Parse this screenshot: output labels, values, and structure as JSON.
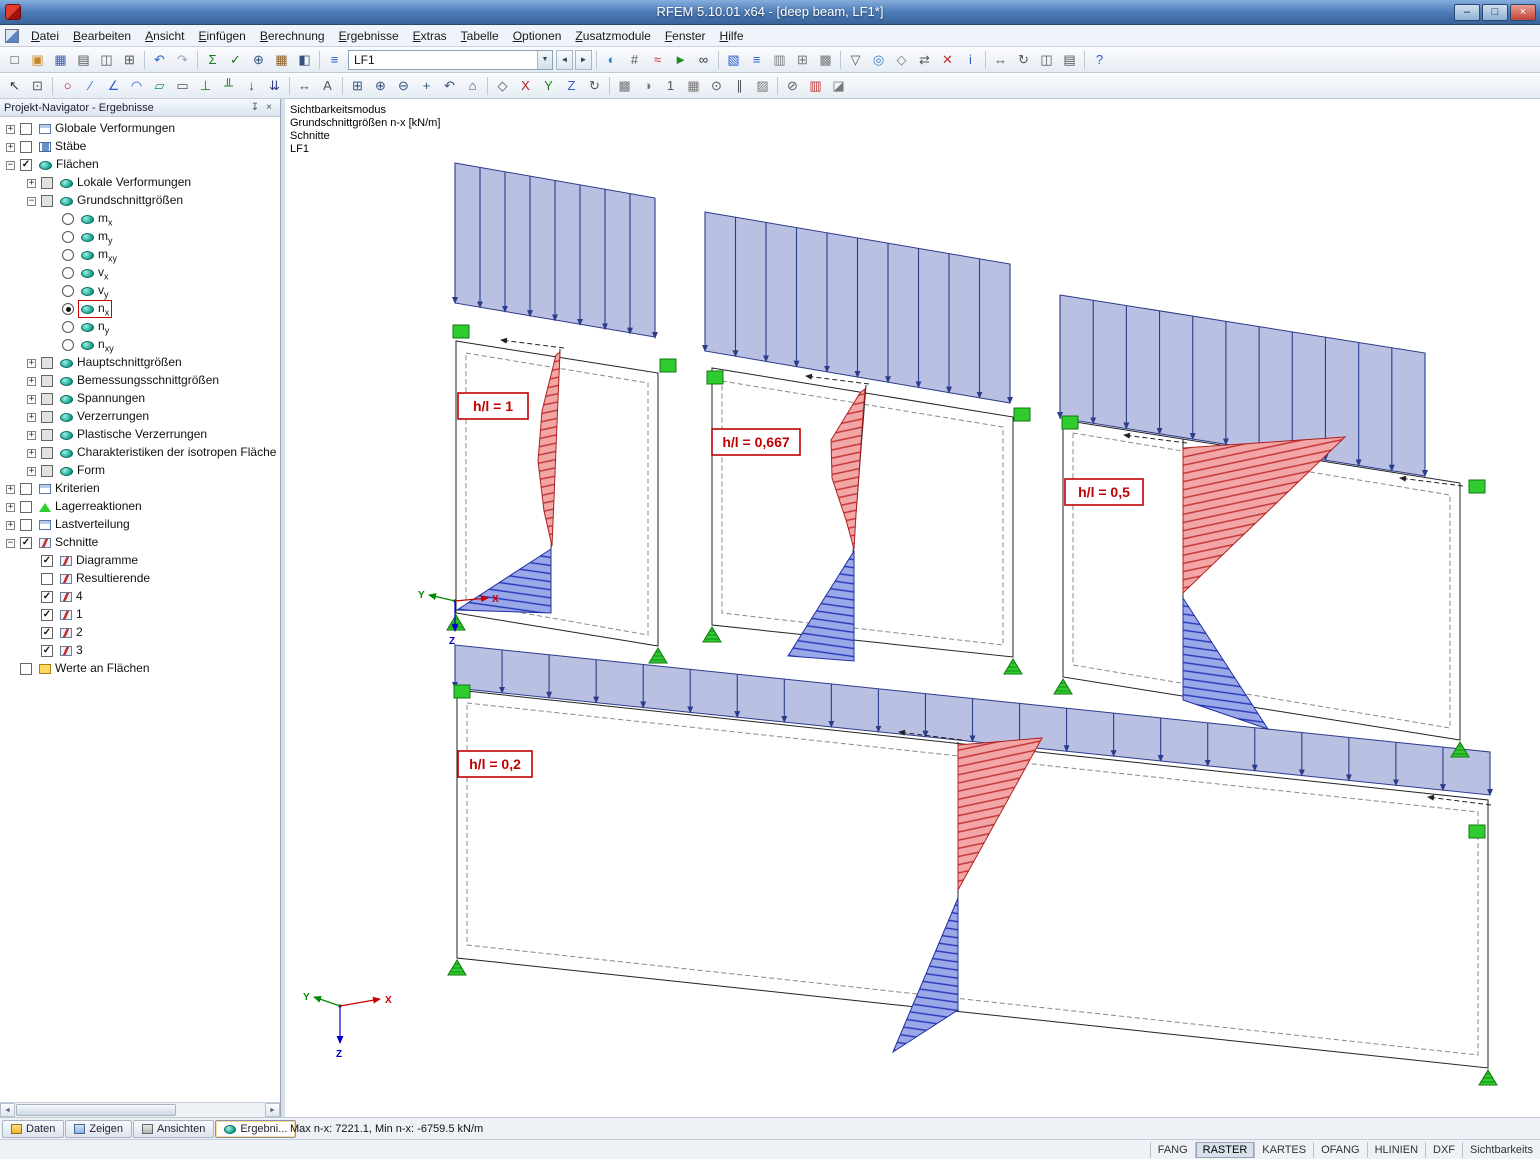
{
  "window": {
    "title": "RFEM 5.10.01 x64 - [deep beam, LF1*]",
    "controls": {
      "minimize": "–",
      "maximize": "□",
      "close": "×"
    }
  },
  "menubar": [
    {
      "n": "menu-datei",
      "label": "Datei"
    },
    {
      "n": "menu-bearbeiten",
      "label": "Bearbeiten"
    },
    {
      "n": "menu-ansicht",
      "label": "Ansicht"
    },
    {
      "n": "menu-einfuegen",
      "label": "Einfügen"
    },
    {
      "n": "menu-berechnung",
      "label": "Berechnung"
    },
    {
      "n": "menu-ergebnisse",
      "label": "Ergebnisse"
    },
    {
      "n": "menu-extras",
      "label": "Extras"
    },
    {
      "n": "menu-tabelle",
      "label": "Tabelle"
    },
    {
      "n": "menu-optionen",
      "label": "Optionen"
    },
    {
      "n": "menu-zusatzmodule",
      "label": "Zusatzmodule"
    },
    {
      "n": "menu-fenster",
      "label": "Fenster"
    },
    {
      "n": "menu-hilfe",
      "label": "Hilfe"
    }
  ],
  "toolbar1": {
    "g1": [
      {
        "n": "new-file-button",
        "g": "□",
        "c": "#444"
      },
      {
        "n": "open-file-button",
        "g": "▣",
        "c": "#c8861f"
      },
      {
        "n": "save-button",
        "g": "▦",
        "c": "#3a5fae"
      },
      {
        "n": "print-button",
        "g": "▤",
        "c": "#555"
      },
      {
        "n": "print-preview-button",
        "g": "◫",
        "c": "#555"
      },
      {
        "n": "copy-button",
        "g": "⊞",
        "c": "#555"
      }
    ],
    "g2": [
      {
        "n": "undo-button",
        "g": "↶",
        "c": "#2b5fd0"
      },
      {
        "n": "redo-button",
        "g": "↷",
        "c": "#9aa4b4"
      }
    ],
    "g3": [
      {
        "n": "calculation-button",
        "g": "Σ",
        "c": "#1a7a1a"
      },
      {
        "n": "check-button",
        "g": "✓",
        "c": "#1a7a1a"
      },
      {
        "n": "zoom-button",
        "g": "⊕",
        "c": "#33527e"
      },
      {
        "n": "tables-button",
        "g": "▦",
        "c": "#8a5a20"
      },
      {
        "n": "navigator-button",
        "g": "◧",
        "c": "#33527e"
      }
    ],
    "load_case": {
      "icon": "≡",
      "value": "LF1",
      "arrow": "▼",
      "prev": "◄",
      "next": "►"
    },
    "g5": [
      {
        "n": "show-results-button",
        "g": "◐",
        "c": "#2b7fd0"
      },
      {
        "n": "result-values-button",
        "g": "#",
        "c": "#555"
      },
      {
        "n": "result-diagrams-button",
        "g": "≈",
        "c": "#c03030"
      },
      {
        "n": "animation-button",
        "g": "►",
        "c": "#1a8a1a"
      },
      {
        "n": "view-results-button",
        "g": "∞",
        "c": "#333"
      }
    ],
    "g6": [
      {
        "n": "colored-results-button",
        "g": "▧",
        "c": "#2b5fd0"
      },
      {
        "n": "isolines-button",
        "g": "≡",
        "c": "#2b5fd0"
      },
      {
        "n": "panel-toggle-button",
        "g": "▥",
        "c": "#777"
      },
      {
        "n": "fe-mesh-button",
        "g": "⊞",
        "c": "#777"
      },
      {
        "n": "mesh-settings-button",
        "g": "▩",
        "c": "#777"
      }
    ],
    "g7": [
      {
        "n": "filter-button",
        "g": "▽",
        "c": "#555"
      },
      {
        "n": "visibility-button",
        "g": "◎",
        "c": "#2b7fd0"
      },
      {
        "n": "user-view-button",
        "g": "◇",
        "c": "#777"
      },
      {
        "n": "mirror-button",
        "g": "⇄",
        "c": "#555"
      },
      {
        "n": "delete-results-button",
        "g": "✕",
        "c": "#c03030"
      },
      {
        "n": "info-button",
        "g": "i",
        "c": "#2b5fd0"
      }
    ],
    "g8": [
      {
        "n": "move-button",
        "g": "↔",
        "c": "#555"
      },
      {
        "n": "rotate-button",
        "g": "↻",
        "c": "#555"
      },
      {
        "n": "new-window-button",
        "g": "◫",
        "c": "#555"
      },
      {
        "n": "print-graphic-button",
        "g": "▤",
        "c": "#555"
      }
    ],
    "g9": [
      {
        "n": "help-button",
        "g": "?",
        "c": "#2b5fd0"
      }
    ]
  },
  "toolbar2": {
    "h1": [
      {
        "n": "select-button",
        "g": "↖",
        "c": "#333"
      },
      {
        "n": "select-window-button",
        "g": "⊡",
        "c": "#555"
      }
    ],
    "h2": [
      {
        "n": "node-button",
        "g": "○",
        "c": "#b02020"
      },
      {
        "n": "line-button",
        "g": "∕",
        "c": "#2b5fd0"
      },
      {
        "n": "polyline-button",
        "g": "∠",
        "c": "#2b5fd0"
      },
      {
        "n": "arc-button",
        "g": "◠",
        "c": "#2b5fd0"
      },
      {
        "n": "surface-button",
        "g": "▱",
        "c": "#1a8a6a"
      },
      {
        "n": "opening-button",
        "g": "▭",
        "c": "#555"
      },
      {
        "n": "node-support-button",
        "g": "⊥",
        "c": "#1a7a1a"
      },
      {
        "n": "line-support-button",
        "g": "╨",
        "c": "#1a7a1a"
      },
      {
        "n": "member-load-button",
        "g": "↓",
        "c": "#2b3c8c"
      },
      {
        "n": "surface-load-button",
        "g": "⇊",
        "c": "#2b3c8c"
      }
    ],
    "h3": [
      {
        "n": "dimension-button",
        "g": "↔",
        "c": "#555"
      },
      {
        "n": "text-button",
        "g": "A",
        "c": "#555"
      }
    ],
    "h4": [
      {
        "n": "zoom-window-button",
        "g": "⊞",
        "c": "#33527e"
      },
      {
        "n": "zoom-in-button",
        "g": "⊕",
        "c": "#33527e"
      },
      {
        "n": "zoom-out-button",
        "g": "⊖",
        "c": "#33527e"
      },
      {
        "n": "pan-button",
        "g": "+",
        "c": "#33527e"
      },
      {
        "n": "previous-view-button",
        "g": "↶",
        "c": "#33527e"
      },
      {
        "n": "show-all-button",
        "g": "⌂",
        "c": "#33527e"
      }
    ],
    "h5": [
      {
        "n": "isometric-view-button",
        "g": "◇",
        "c": "#555"
      },
      {
        "n": "view-x-button",
        "g": "X",
        "c": "#b02020"
      },
      {
        "n": "view-y-button",
        "g": "Y",
        "c": "#1a7a1a"
      },
      {
        "n": "view-z-button",
        "g": "Z",
        "c": "#2b5fd0"
      },
      {
        "n": "rotate-view-button",
        "g": "↻",
        "c": "#555"
      }
    ],
    "h6": [
      {
        "n": "render-button",
        "g": "▩",
        "c": "#777"
      },
      {
        "n": "shadow-button",
        "g": "◑",
        "c": "#777"
      },
      {
        "n": "numbering-button",
        "g": "1",
        "c": "#555"
      },
      {
        "n": "grid-button",
        "g": "▦",
        "c": "#777"
      },
      {
        "n": "snap-button",
        "g": "⊙",
        "c": "#555"
      },
      {
        "n": "guidelines-button",
        "g": "∥",
        "c": "#555"
      },
      {
        "n": "work-plane-button",
        "g": "▨",
        "c": "#777"
      }
    ],
    "h7": [
      {
        "n": "clipping-button",
        "g": "⊘",
        "c": "#555"
      },
      {
        "n": "color-scale-button",
        "g": "▥",
        "c": "#c03030"
      },
      {
        "n": "background-button",
        "g": "◪",
        "c": "#777"
      }
    ]
  },
  "navigator": {
    "title": "Projekt-Navigator - Ergebnisse",
    "pin": "↧",
    "close": "×",
    "scrollbar": {
      "left": "◄",
      "right": "►"
    },
    "tree": [
      {
        "n": "tree-item-globale-verformungen",
        "label": "Globale Verformungen",
        "sub": "",
        "lvl": 0,
        "exp": "+",
        "chk": "box",
        "icon": "ic-window"
      },
      {
        "n": "tree-item-staebe",
        "label": "Stäbe",
        "sub": "",
        "lvl": 0,
        "exp": "+",
        "chk": "box",
        "icon": "ic-beam"
      },
      {
        "n": "tree-item-flaechen",
        "label": "Flächen",
        "sub": "",
        "lvl": 0,
        "exp": "−",
        "chk": "box on",
        "icon": "ic-oval"
      },
      {
        "n": "tree-item-lokale-verformungen",
        "label": "Lokale Verformungen",
        "sub": "",
        "lvl": 1,
        "exp": "+",
        "chk": "box grey",
        "icon": "ic-oval"
      },
      {
        "n": "tree-item-grundschnittgroessen",
        "label": "Grundschnittgrößen",
        "sub": "",
        "lvl": 1,
        "exp": "−",
        "chk": "box grey",
        "icon": "ic-oval"
      },
      {
        "n": "tree-item-mx",
        "label": "m",
        "sub": "x",
        "lvl": 2,
        "exp": "",
        "chk": "radio",
        "icon": "ic-oval"
      },
      {
        "n": "tree-item-my",
        "label": "m",
        "sub": "y",
        "lvl": 2,
        "exp": "",
        "chk": "radio",
        "icon": "ic-oval"
      },
      {
        "n": "tree-item-mxy",
        "label": "m",
        "sub": "xy",
        "lvl": 2,
        "exp": "",
        "chk": "radio",
        "icon": "ic-oval"
      },
      {
        "n": "tree-item-vx",
        "label": "v",
        "sub": "x",
        "lvl": 2,
        "exp": "",
        "chk": "radio",
        "icon": "ic-oval"
      },
      {
        "n": "tree-item-vy",
        "label": "v",
        "sub": "y",
        "lvl": 2,
        "exp": "",
        "chk": "radio",
        "icon": "ic-oval"
      },
      {
        "n": "tree-item-nx",
        "label": "n",
        "sub": "x",
        "lvl": 2,
        "exp": "",
        "chk": "radio on",
        "icon": "ic-oval",
        "sel": "sel"
      },
      {
        "n": "tree-item-ny",
        "label": "n",
        "sub": "y",
        "lvl": 2,
        "exp": "",
        "chk": "radio",
        "icon": "ic-oval"
      },
      {
        "n": "tree-item-nxy",
        "label": "n",
        "sub": "xy",
        "lvl": 2,
        "exp": "",
        "chk": "radio",
        "icon": "ic-oval"
      },
      {
        "n": "tree-item-hauptschnittgroessen",
        "label": "Hauptschnittgrößen",
        "sub": "",
        "lvl": 1,
        "exp": "+",
        "chk": "box grey",
        "icon": "ic-oval"
      },
      {
        "n": "tree-item-bemessungsschnittgroessen",
        "label": "Bemessungsschnittgrößen",
        "sub": "",
        "lvl": 1,
        "exp": "+",
        "chk": "box grey",
        "icon": "ic-oval"
      },
      {
        "n": "tree-item-spannungen",
        "label": "Spannungen",
        "sub": "",
        "lvl": 1,
        "exp": "+",
        "chk": "box grey",
        "icon": "ic-oval"
      },
      {
        "n": "tree-item-verzerrungen",
        "label": "Verzerrungen",
        "sub": "",
        "lvl": 1,
        "exp": "+",
        "chk": "box grey",
        "icon": "ic-oval"
      },
      {
        "n": "tree-item-plastische-verzerrungen",
        "label": "Plastische Verzerrungen",
        "sub": "",
        "lvl": 1,
        "exp": "+",
        "chk": "box grey",
        "icon": "ic-oval"
      },
      {
        "n": "tree-item-charakteristiken",
        "label": "Charakteristiken der isotropen Fläche",
        "sub": "",
        "lvl": 1,
        "exp": "+",
        "chk": "box grey",
        "icon": "ic-oval"
      },
      {
        "n": "tree-item-form",
        "label": "Form",
        "sub": "",
        "lvl": 1,
        "exp": "+",
        "chk": "box grey",
        "icon": "ic-oval"
      },
      {
        "n": "tree-item-kriterien",
        "label": "Kriterien",
        "sub": "",
        "lvl": 0,
        "exp": "+",
        "chk": "box",
        "icon": "ic-window"
      },
      {
        "n": "tree-item-lagerreaktionen",
        "label": "Lagerreaktionen",
        "sub": "",
        "lvl": 0,
        "exp": "+",
        "chk": "box",
        "icon": "ic-support"
      },
      {
        "n": "tree-item-lastverteilung",
        "label": "Lastverteilung",
        "sub": "",
        "lvl": 0,
        "exp": "+",
        "chk": "box",
        "icon": "ic-window"
      },
      {
        "n": "tree-item-schnitte",
        "label": "Schnitte",
        "sub": "",
        "lvl": 0,
        "exp": "−",
        "chk": "box on",
        "icon": "ic-section"
      },
      {
        "n": "tree-item-diagramme",
        "label": "Diagramme",
        "sub": "",
        "lvl": 1,
        "exp": "",
        "chk": "box on",
        "icon": "ic-section"
      },
      {
        "n": "tree-item-resultierende",
        "label": "Resultierende",
        "sub": "",
        "lvl": 1,
        "exp": "",
        "chk": "box",
        "icon": "ic-section"
      },
      {
        "n": "tree-item-schnitt-4",
        "label": "4",
        "sub": "",
        "lvl": 1,
        "exp": "",
        "chk": "box on",
        "icon": "ic-section"
      },
      {
        "n": "tree-item-schnitt-1",
        "label": "1",
        "sub": "",
        "lvl": 1,
        "exp": "",
        "chk": "box on",
        "icon": "ic-section"
      },
      {
        "n": "tree-item-schnitt-2",
        "label": "2",
        "sub": "",
        "lvl": 1,
        "exp": "",
        "chk": "box on",
        "icon": "ic-section"
      },
      {
        "n": "tree-item-schnitt-3",
        "label": "3",
        "sub": "",
        "lvl": 1,
        "exp": "",
        "chk": "box on",
        "icon": "ic-section"
      },
      {
        "n": "tree-item-werte-an-flaechen",
        "label": "Werte an Flächen",
        "sub": "",
        "lvl": 0,
        "exp": "",
        "chk": "box",
        "icon": "ic-xls"
      }
    ]
  },
  "tabs": [
    {
      "n": "tab-daten",
      "label": "Daten",
      "icon": "tabic-daten"
    },
    {
      "n": "tab-zeigen",
      "label": "Zeigen",
      "icon": "tabic-zeigen"
    },
    {
      "n": "tab-ansichten",
      "label": "Ansichten",
      "icon": "tabic-ansichten"
    },
    {
      "n": "tab-ergebnisse",
      "label": "Ergebni...",
      "icon": "tabic-ergebnisse",
      "cls": "active"
    }
  ],
  "result_info": "Max n-x: 7221.1, Min n-x: -6759.5 kN/m",
  "statusbar": [
    {
      "n": "statusbar-toggle-fang",
      "label": "FANG"
    },
    {
      "n": "statusbar-toggle-raster",
      "label": "RASTER",
      "cls": "on"
    },
    {
      "n": "statusbar-toggle-kartes",
      "label": "KARTES"
    },
    {
      "n": "statusbar-toggle-ofang",
      "label": "OFANG"
    },
    {
      "n": "statusbar-toggle-hlinien",
      "label": "HLINIEN"
    },
    {
      "n": "statusbar-toggle-dxf",
      "label": "DXF"
    },
    {
      "n": "statusbar-toggle-sichtbarkeits",
      "label": "Sichtbarkeits"
    }
  ],
  "canvas": {
    "info_lines": [
      "Sichtbarkeitsmodus",
      "Grundschnittgrößen n-x [kN/m]",
      "Schnitte",
      "LF1"
    ],
    "labels": {
      "p1": "h/l = 1",
      "p2": "h/l = 0,667",
      "p3": "h/l = 0,5",
      "p4": "h/l = 0,2"
    },
    "axes": {
      "x": "X",
      "y": "Y",
      "z": "Z"
    },
    "colors": {
      "label_red": "#c00000",
      "tension_red": "#c23030",
      "compression_blue": "#2535b8",
      "support_green": "#2ecc2e",
      "load_blue": "#2b3c8c"
    }
  }
}
